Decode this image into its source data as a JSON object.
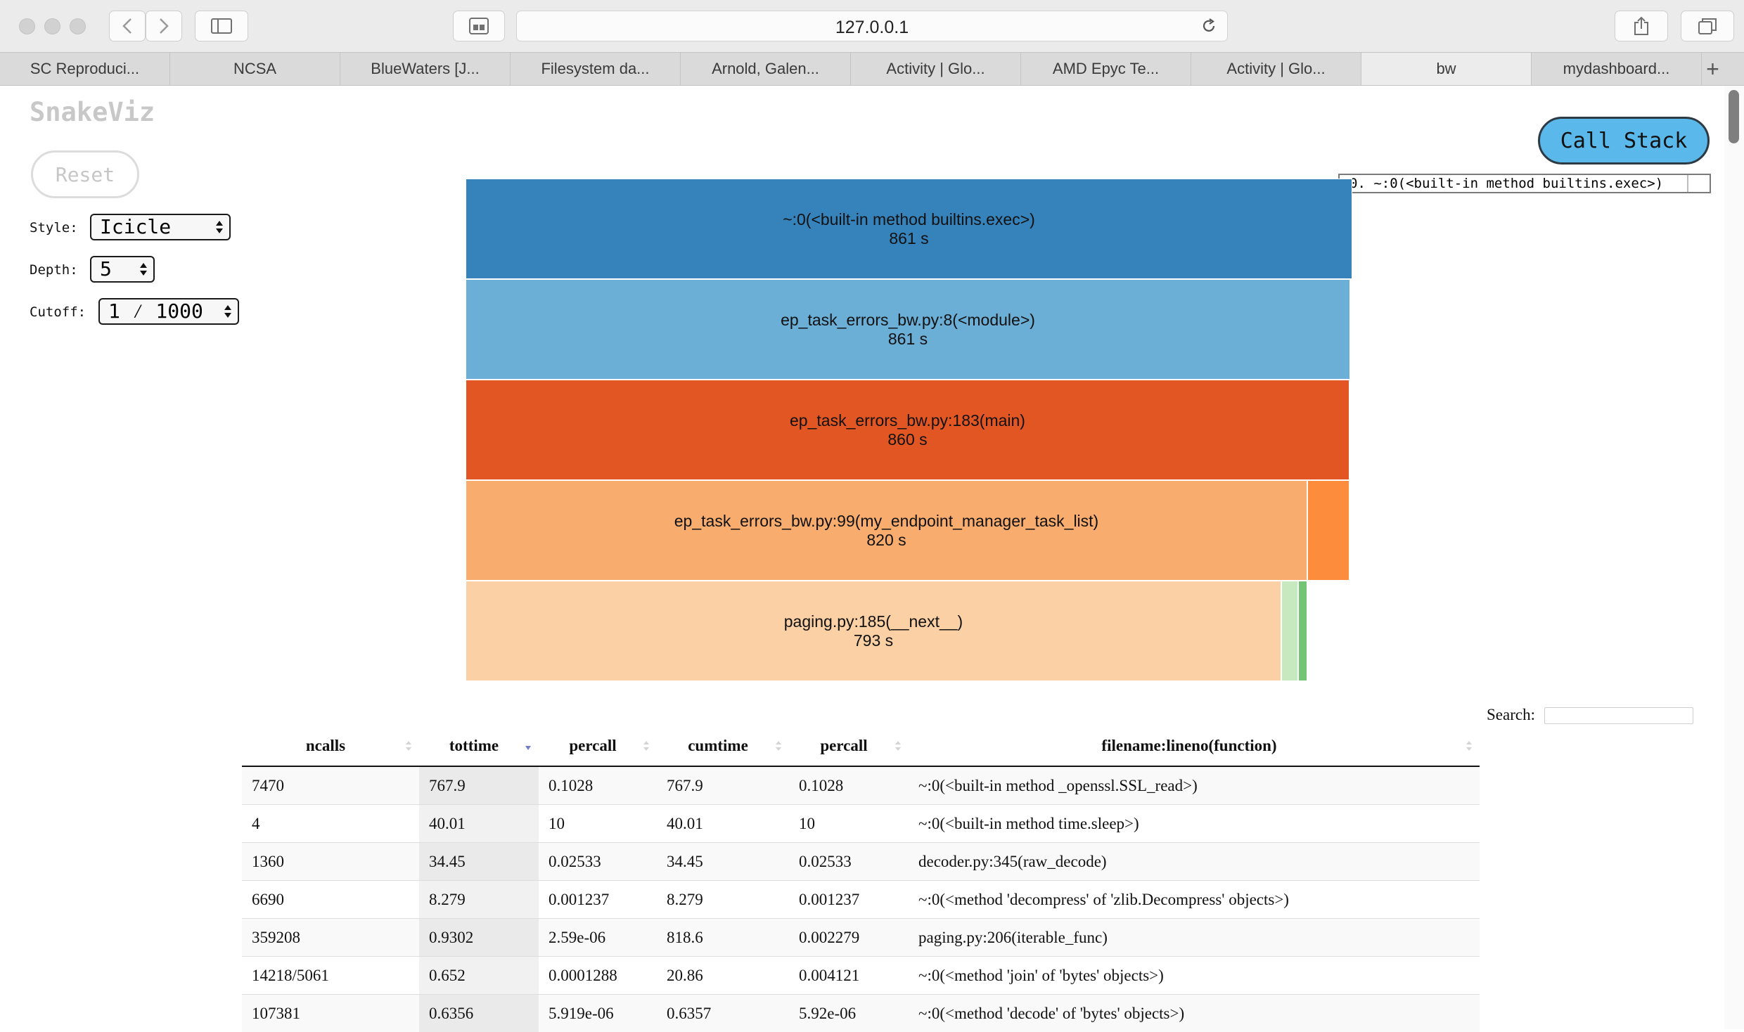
{
  "browser": {
    "url": "127.0.0.1",
    "tabs": [
      {
        "label": "SC Reproduci..."
      },
      {
        "label": "NCSA"
      },
      {
        "label": "BlueWaters [J..."
      },
      {
        "label": "Filesystem da..."
      },
      {
        "label": "Arnold, Galen..."
      },
      {
        "label": "Activity | Glo..."
      },
      {
        "label": "AMD Epyc Te..."
      },
      {
        "label": "Activity | Glo..."
      },
      {
        "label": "bw"
      },
      {
        "label": "mydashboard..."
      }
    ],
    "new_tab_label": "+",
    "icons": [
      "close-dot",
      "minimize-dot",
      "zoom-dot",
      "back-chevron",
      "forward-chevron",
      "sidebar-icon",
      "reader-icon",
      "reload-icon",
      "share-icon",
      "tabs-overview-icon"
    ]
  },
  "app": {
    "title": "SnakeViz",
    "reset_label": "Reset",
    "style_label": "Style:",
    "style_value": "Icicle",
    "depth_label": "Depth:",
    "depth_value": "5",
    "cutoff_label": "Cutoff:",
    "cutoff_value": "1 ⁄ 1000",
    "call_stack_label": "Call Stack",
    "call_stack_entries": [
      "0. ~:0(<built-in method builtins.exec>)"
    ]
  },
  "icicle": {
    "levels": [
      {
        "name": "~:0(<built-in method builtins.exec>)",
        "time": "861 s",
        "color": "#3683bc"
      },
      {
        "name": "ep_task_errors_bw.py:8(<module>)",
        "time": "861 s",
        "color": "#6baed6"
      },
      {
        "name": "ep_task_errors_bw.py:183(main)",
        "time": "860 s",
        "color": "#e25624"
      },
      {
        "name": "ep_task_errors_bw.py:99(my_endpoint_manager_task_list)",
        "time": "820 s",
        "color": "#f8ac6e"
      },
      {
        "name": "paging.py:185(__next__)",
        "time": "793 s",
        "color": "#fad0a4"
      }
    ],
    "minor_colors": {
      "orange": "#fd8d3c",
      "light_green": "#c7e9c0",
      "green": "#74c476"
    }
  },
  "search": {
    "label": "Search:",
    "value": ""
  },
  "table": {
    "columns": [
      "ncalls",
      "tottime",
      "percall",
      "cumtime",
      "percall",
      "filename:lineno(function)"
    ],
    "sorted_column": "tottime",
    "sort_direction": "descending",
    "rows": [
      [
        "7470",
        "767.9",
        "0.1028",
        "767.9",
        "0.1028",
        "~:0(<built-in method _openssl.SSL_read>)"
      ],
      [
        "4",
        "40.01",
        "10",
        "40.01",
        "10",
        "~:0(<built-in method time.sleep>)"
      ],
      [
        "1360",
        "34.45",
        "0.02533",
        "34.45",
        "0.02533",
        "decoder.py:345(raw_decode)"
      ],
      [
        "6690",
        "8.279",
        "0.001237",
        "8.279",
        "0.001237",
        "~:0(<method 'decompress' of 'zlib.Decompress' objects>)"
      ],
      [
        "359208",
        "0.9302",
        "2.59e-06",
        "818.6",
        "0.002279",
        "paging.py:206(iterable_func)"
      ],
      [
        "14218/5061",
        "0.652",
        "0.0001288",
        "20.86",
        "0.004121",
        "~:0(<method 'join' of 'bytes' objects>)"
      ],
      [
        "107381",
        "0.6356",
        "5.919e-06",
        "0.6357",
        "5.92e-06",
        "~:0(<method 'decode' of 'bytes' objects>)"
      ]
    ]
  }
}
